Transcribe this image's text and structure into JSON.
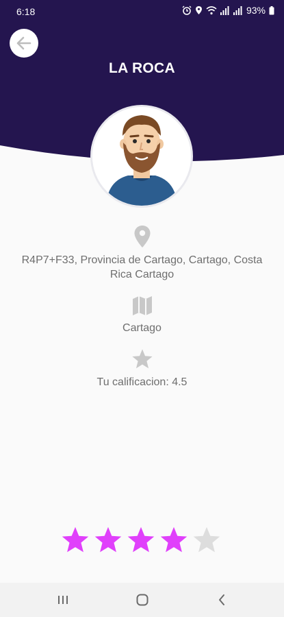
{
  "status_bar": {
    "time": "6:18",
    "battery": "93%"
  },
  "header": {
    "title": "LA ROCA",
    "background_color": "#24154f"
  },
  "place": {
    "address_icon": "location-pin-icon",
    "address": "R4P7+F33, Provincia de Cartago, Cartago, Costa Rica Cartago",
    "city_icon": "map-icon",
    "city": "Cartago",
    "rating_icon": "star-icon",
    "rating_text": "Tu calificacion: 4.5"
  },
  "rating_input": {
    "value": 4,
    "max": 5,
    "active_color": "#e040fb",
    "inactive_color": "#dddddd"
  },
  "nav_bar": {
    "recent_icon": "recent-apps-icon",
    "home_icon": "home-icon",
    "back_icon": "back-chevron-icon"
  }
}
